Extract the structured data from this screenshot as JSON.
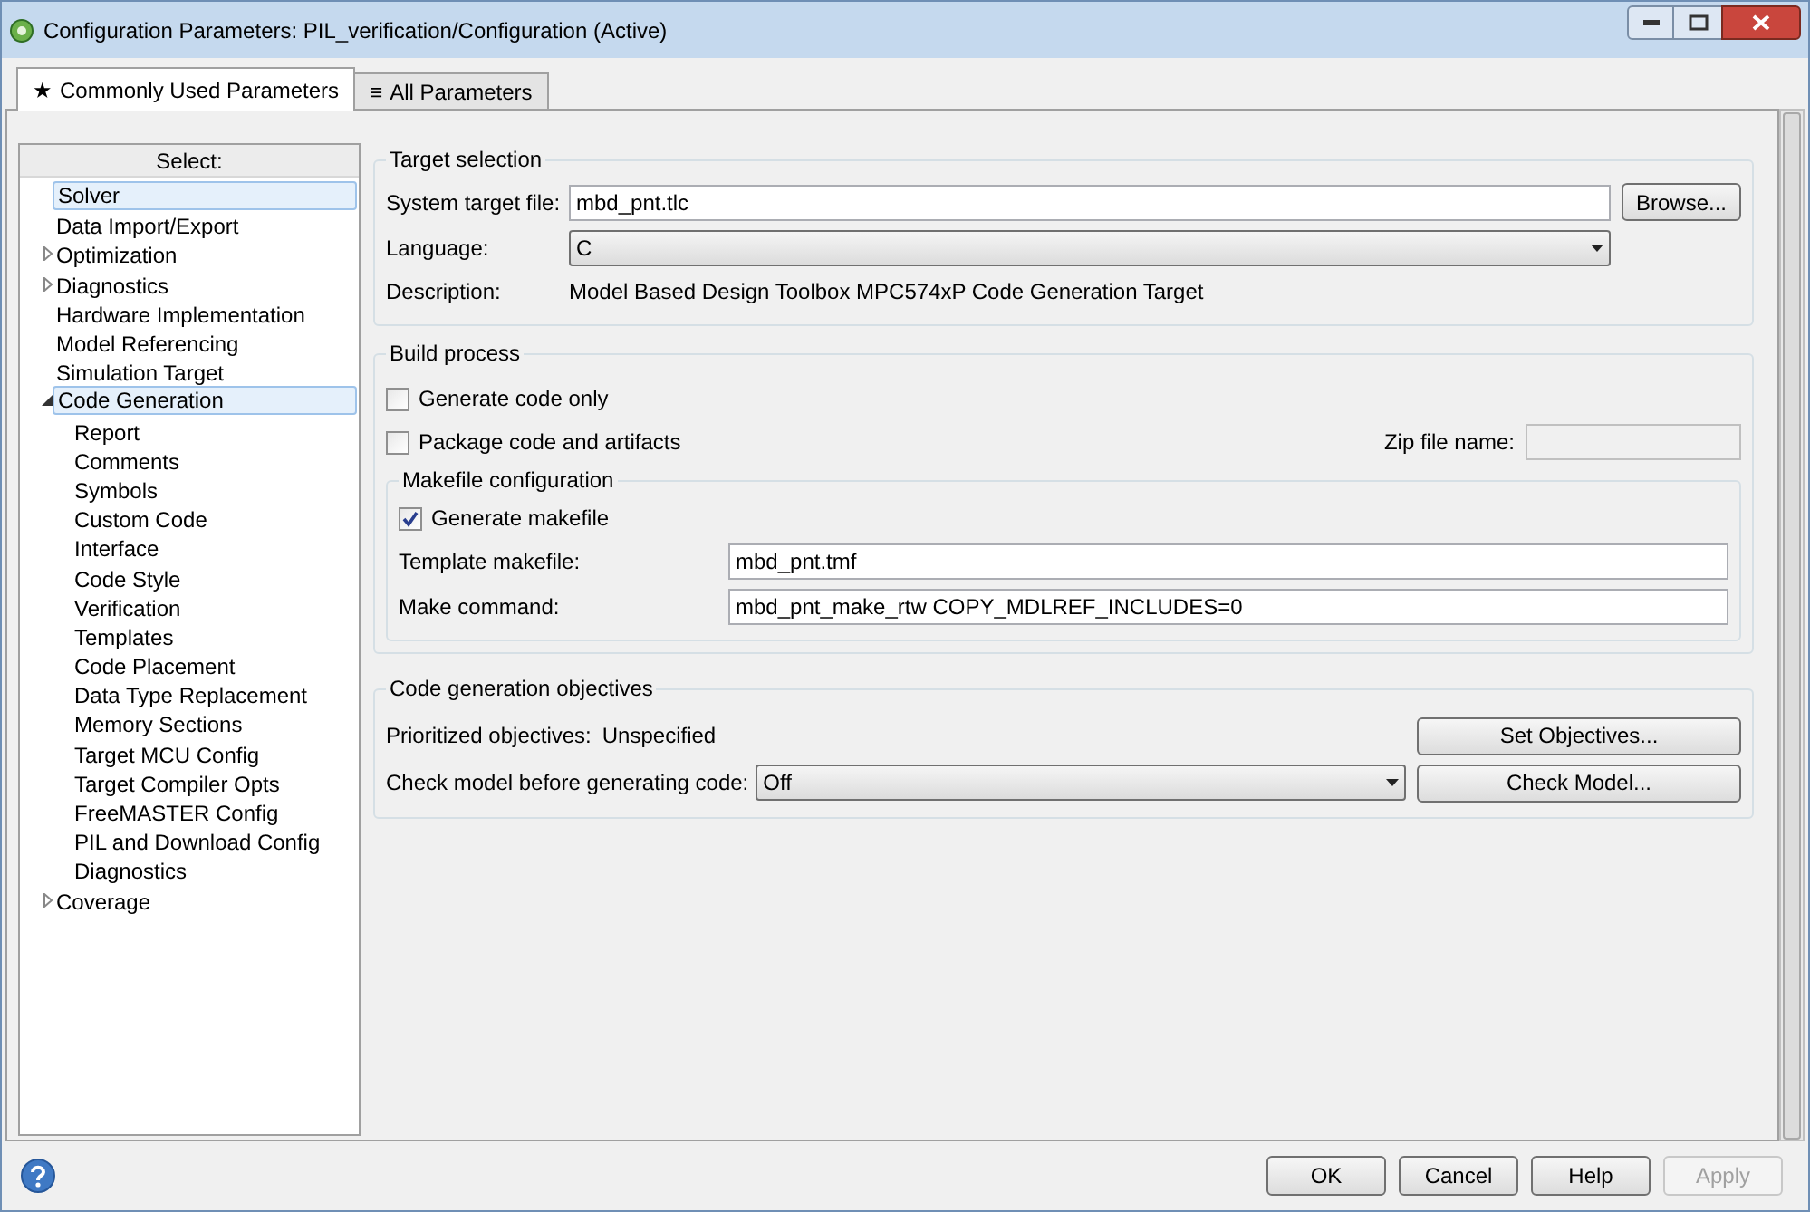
{
  "window": {
    "title": "Configuration Parameters: PIL_verification/Configuration (Active)"
  },
  "tabs": [
    {
      "icon": "★",
      "label": "Commonly Used Parameters",
      "selected": true
    },
    {
      "icon": "≡",
      "label": "All Parameters",
      "selected": false
    }
  ],
  "sidebar": {
    "header": "Select:",
    "items": [
      {
        "label": "Solver",
        "selected": true
      },
      {
        "label": "Data Import/Export",
        "selected": false
      },
      {
        "label": "Optimization",
        "selected": false,
        "expanded": false
      },
      {
        "label": "Diagnostics",
        "selected": false,
        "expanded": false
      },
      {
        "label": "Hardware Implementation",
        "selected": false
      },
      {
        "label": "Model Referencing",
        "selected": false
      },
      {
        "label": "Simulation Target",
        "selected": false
      },
      {
        "label": "Code Generation",
        "selected": true,
        "expanded": true,
        "children": [
          {
            "label": "Report",
            "selected": false
          },
          {
            "label": "Comments",
            "selected": false
          },
          {
            "label": "Symbols",
            "selected": false
          },
          {
            "label": "Custom Code",
            "selected": false
          },
          {
            "label": "Interface",
            "selected": false
          },
          {
            "label": "Code Style",
            "selected": false
          },
          {
            "label": "Verification",
            "selected": false
          },
          {
            "label": "Templates",
            "selected": false
          },
          {
            "label": "Code Placement",
            "selected": false
          },
          {
            "label": "Data Type Replacement",
            "selected": false
          },
          {
            "label": "Memory Sections",
            "selected": false
          },
          {
            "label": "Target MCU Config",
            "selected": false
          },
          {
            "label": "Target Compiler Opts",
            "selected": false
          },
          {
            "label": "FreeMASTER Config",
            "selected": false
          },
          {
            "label": "PIL and Download Config",
            "selected": false
          },
          {
            "label": "Diagnostics",
            "selected": false
          }
        ]
      },
      {
        "label": "Coverage",
        "selected": false,
        "expanded": false
      }
    ]
  },
  "target_selection": {
    "title": "Target selection",
    "system_target_file": {
      "label": "System target file:",
      "value": "mbd_pnt.tlc"
    },
    "browse_button": "Browse...",
    "language": {
      "label": "Language:",
      "value": "C"
    },
    "description": {
      "label": "Description:",
      "value": "Model Based Design Toolbox MPC574xP Code Generation Target"
    }
  },
  "build_process": {
    "title": "Build process",
    "checkboxes": [
      {
        "label": "Generate code only",
        "checked": false
      },
      {
        "label": "Package code and artifacts",
        "checked": false
      }
    ],
    "zip_file_name": {
      "label": "Zip file name:",
      "disabled": true
    },
    "makefile_configuration": {
      "title": "Makefile configuration",
      "generate_makefile": {
        "label": "Generate makefile",
        "checked": true
      },
      "template_makefile": {
        "label": "Template makefile:",
        "value": "mbd_pnt.tmf"
      },
      "make_command": {
        "label": "Make command:",
        "value": "mbd_pnt_make_rtw COPY_MDLREF_INCLUDES=0"
      }
    }
  },
  "code_generation_objectives": {
    "title": "Code generation objectives",
    "prioritized_objectives": {
      "label": "Prioritized objectives:",
      "value": "Unspecified"
    },
    "set_objectives_button": "Set Objectives...",
    "check_model": {
      "label": "Check model before generating code:",
      "value": "Off"
    },
    "check_model_button": "Check Model..."
  },
  "buttons": [
    {
      "label": "OK",
      "disabled": false
    },
    {
      "label": "Cancel",
      "disabled": false
    },
    {
      "label": "Help",
      "disabled": false
    },
    {
      "label": "Apply",
      "disabled": true
    }
  ]
}
